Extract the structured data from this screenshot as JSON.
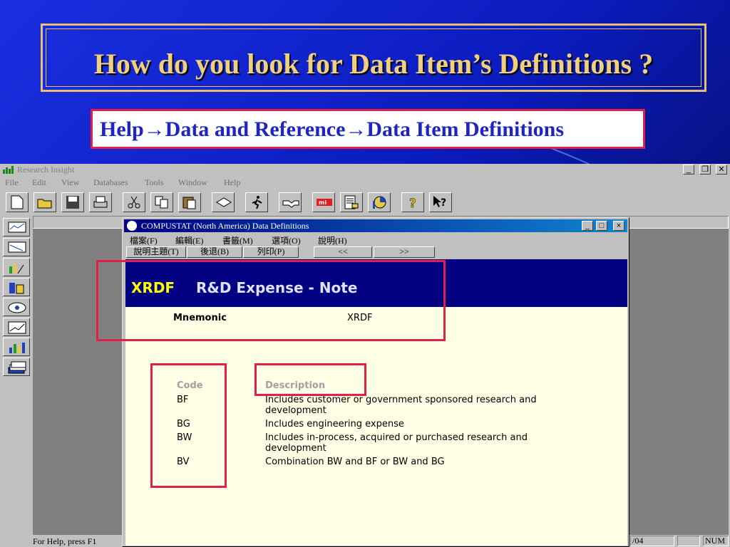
{
  "slide": {
    "title": "How do you look for Data Item’s Definitions ?",
    "help_path": "Help→Data and Reference→Data Item Definitions"
  },
  "app": {
    "title": "Research Insight",
    "menu": [
      "File",
      "Edit",
      "View",
      "Databases",
      "Tools",
      "Window",
      "Help"
    ],
    "window_controls": {
      "minimize": "_",
      "restore": "❐",
      "close": "✕"
    },
    "toolbar_icons": [
      "new-icon",
      "open-icon",
      "save-icon",
      "print-icon",
      "cut-icon",
      "copy-icon",
      "paste-icon",
      "sort-icon",
      "run-icon",
      "handshake-icon",
      "mi-icon",
      "report-icon",
      "chart-icon",
      "help-icon",
      "context-help-icon"
    ],
    "sidebar_icons": [
      "screen-icon",
      "screen-2-icon",
      "chart-view-icon",
      "building-icon",
      "report-view-icon",
      "graph-icon",
      "bar-chart-icon",
      "stack-icon"
    ],
    "status": {
      "help": "For Help, press F1",
      "date": "/04",
      "num": "NUM"
    }
  },
  "dialog": {
    "title": "COMPUSTAT (North America) Data Definitions",
    "menu": [
      "檔案(F)",
      "編輯(E)",
      "書籤(M)",
      "選項(O)",
      "說明(H)"
    ],
    "buttons": [
      "說明主題(T)",
      "後退(B)",
      "列印(P)",
      "<<",
      ">>"
    ],
    "controls": {
      "minimize": "_",
      "maximize": "□",
      "close": "×"
    },
    "mnemonic_code": "XRDF",
    "item_title": "R&D Expense - Note",
    "mnemonic_label": "Mnemonic",
    "mnemonic_value": "XRDF",
    "code_header": "Code",
    "description_header": "Description",
    "rows": [
      {
        "code": "BF",
        "description": "Includes customer or government sponsored research and development"
      },
      {
        "code": "BG",
        "description": "Includes engineering expense"
      },
      {
        "code": "BW",
        "description": "Includes in-process, acquired or purchased research and development"
      },
      {
        "code": "BV",
        "description": "Combination BW and BF or BW and BG"
      }
    ]
  }
}
